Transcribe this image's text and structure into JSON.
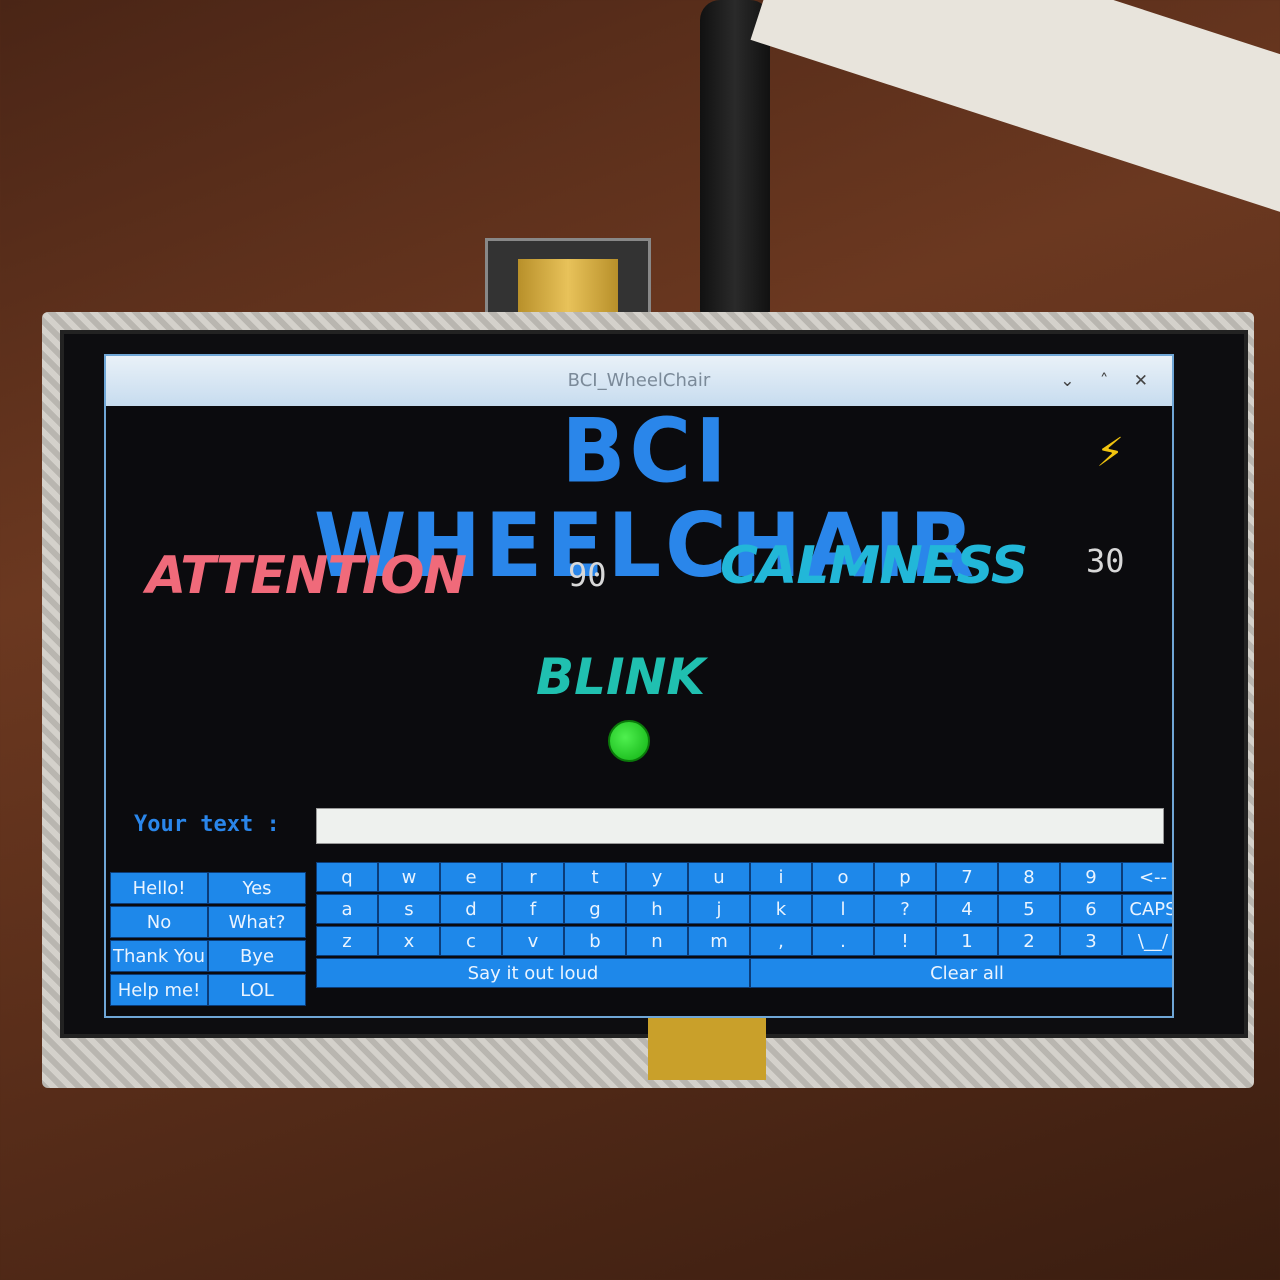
{
  "window": {
    "title": "BCI_WheelChair",
    "controls": "⌄ ˄ ✕"
  },
  "app": {
    "title": "BCI WHEELCHAIR",
    "status_icon": "⚡"
  },
  "metrics": {
    "attention_label": "ATTENTION",
    "attention_value": "90",
    "calmness_label": "CALMNESS",
    "calmness_value": "30",
    "blink_label": "BLINK",
    "blink_indicator_color": "#12c012"
  },
  "text_entry": {
    "label": "Your text :",
    "value": ""
  },
  "phrases": [
    "Hello!",
    "Yes",
    "No",
    "What?",
    "Thank You",
    "Bye",
    "Help me!",
    "LOL"
  ],
  "keyboard": {
    "rows": [
      [
        "q",
        "w",
        "e",
        "r",
        "t",
        "y",
        "u",
        "i",
        "o",
        "p",
        "7",
        "8",
        "9",
        "<--"
      ],
      [
        "a",
        "s",
        "d",
        "f",
        "g",
        "h",
        "j",
        "k",
        "l",
        "?",
        "4",
        "5",
        "6",
        "CAPS"
      ],
      [
        "z",
        "x",
        "c",
        "v",
        "b",
        "n",
        "m",
        ",",
        ".",
        "!",
        "1",
        "2",
        "3",
        "\\__/"
      ]
    ],
    "speak_label": "Say it out loud",
    "clear_label": "Clear all"
  },
  "colors": {
    "accent": "#1e88ea",
    "attention": "#f06a7a",
    "calmness": "#22b7d8",
    "blink": "#20c0b0"
  }
}
